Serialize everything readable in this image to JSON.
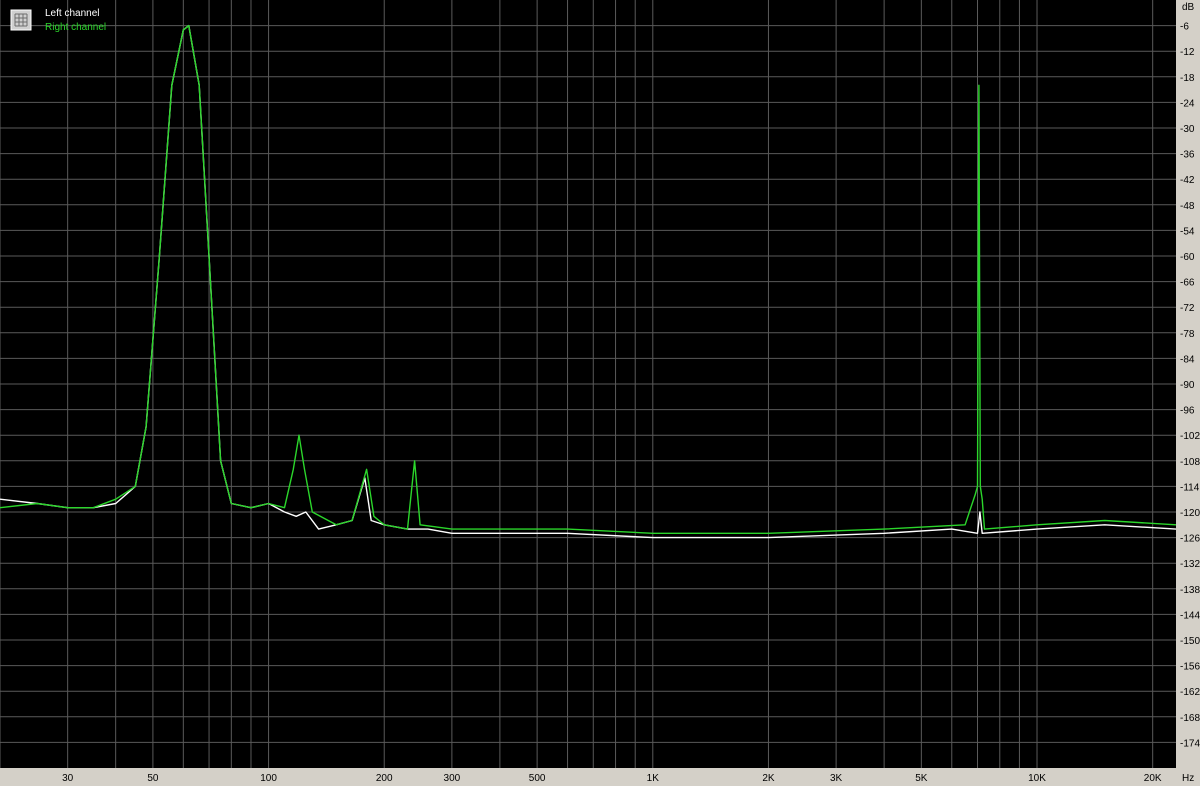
{
  "legend": {
    "left_label": "Left channel",
    "right_label": "Right channel",
    "left_color": "#ffffff",
    "right_color": "#2bd62b"
  },
  "chart_data": {
    "type": "line",
    "xscale": "log",
    "xlim": [
      20,
      23000
    ],
    "ylim": [
      -180,
      0
    ],
    "y_unit": "dB",
    "x_unit": "Hz",
    "grid": true,
    "legend_position": "top-left",
    "background": "#000000",
    "grid_color": "#5a5a5a",
    "x_tick_labels": [
      {
        "v": 30,
        "t": "30"
      },
      {
        "v": 50,
        "t": "50"
      },
      {
        "v": 100,
        "t": "100"
      },
      {
        "v": 200,
        "t": "200"
      },
      {
        "v": 300,
        "t": "300"
      },
      {
        "v": 500,
        "t": "500"
      },
      {
        "v": 1000,
        "t": "1K"
      },
      {
        "v": 2000,
        "t": "2K"
      },
      {
        "v": 3000,
        "t": "3K"
      },
      {
        "v": 5000,
        "t": "5K"
      },
      {
        "v": 10000,
        "t": "10K"
      },
      {
        "v": 20000,
        "t": "20K"
      }
    ],
    "y_ticks": [
      -6,
      -12,
      -18,
      -24,
      -30,
      -36,
      -42,
      -48,
      -54,
      -60,
      -66,
      -72,
      -78,
      -84,
      -90,
      -96,
      -102,
      -108,
      -114,
      -120,
      -126,
      -132,
      -138,
      -144,
      -150,
      -156,
      -162,
      -168,
      -174
    ],
    "series": [
      {
        "name": "Left channel",
        "color": "#ffffff",
        "points": [
          [
            20,
            -117
          ],
          [
            25,
            -118
          ],
          [
            30,
            -119
          ],
          [
            35,
            -119
          ],
          [
            40,
            -118
          ],
          [
            45,
            -114
          ],
          [
            48,
            -100
          ],
          [
            52,
            -60
          ],
          [
            56,
            -20
          ],
          [
            60,
            -7
          ],
          [
            62,
            -6
          ],
          [
            66,
            -20
          ],
          [
            70,
            -60
          ],
          [
            75,
            -108
          ],
          [
            80,
            -118
          ],
          [
            90,
            -119
          ],
          [
            100,
            -118
          ],
          [
            110,
            -120
          ],
          [
            118,
            -121
          ],
          [
            125,
            -120
          ],
          [
            135,
            -124
          ],
          [
            150,
            -123
          ],
          [
            165,
            -122
          ],
          [
            178,
            -112
          ],
          [
            185,
            -122
          ],
          [
            200,
            -123
          ],
          [
            230,
            -124
          ],
          [
            260,
            -124
          ],
          [
            300,
            -125
          ],
          [
            400,
            -125
          ],
          [
            600,
            -125
          ],
          [
            1000,
            -126
          ],
          [
            2000,
            -126
          ],
          [
            4000,
            -125
          ],
          [
            6000,
            -124
          ],
          [
            7000,
            -125
          ],
          [
            7100,
            -120
          ],
          [
            7200,
            -125
          ],
          [
            10000,
            -124
          ],
          [
            15000,
            -123
          ],
          [
            23000,
            -124
          ]
        ]
      },
      {
        "name": "Right channel",
        "color": "#2bd62b",
        "points": [
          [
            20,
            -119
          ],
          [
            25,
            -118
          ],
          [
            30,
            -119
          ],
          [
            35,
            -119
          ],
          [
            40,
            -117
          ],
          [
            45,
            -114
          ],
          [
            48,
            -100
          ],
          [
            52,
            -60
          ],
          [
            56,
            -20
          ],
          [
            60,
            -7
          ],
          [
            62,
            -6
          ],
          [
            66,
            -20
          ],
          [
            70,
            -60
          ],
          [
            75,
            -108
          ],
          [
            80,
            -118
          ],
          [
            90,
            -119
          ],
          [
            100,
            -118
          ],
          [
            110,
            -119
          ],
          [
            116,
            -110
          ],
          [
            120,
            -102
          ],
          [
            124,
            -110
          ],
          [
            130,
            -120
          ],
          [
            150,
            -123
          ],
          [
            165,
            -122
          ],
          [
            180,
            -110
          ],
          [
            188,
            -121
          ],
          [
            200,
            -123
          ],
          [
            230,
            -124
          ],
          [
            240,
            -108
          ],
          [
            248,
            -123
          ],
          [
            300,
            -124
          ],
          [
            400,
            -124
          ],
          [
            600,
            -124
          ],
          [
            1000,
            -125
          ],
          [
            2000,
            -125
          ],
          [
            4000,
            -124
          ],
          [
            6500,
            -123
          ],
          [
            6900,
            -116
          ],
          [
            7000,
            -114
          ],
          [
            7060,
            -20
          ],
          [
            7120,
            -114
          ],
          [
            7200,
            -117
          ],
          [
            7300,
            -124
          ],
          [
            10000,
            -123
          ],
          [
            15000,
            -122
          ],
          [
            23000,
            -123
          ]
        ]
      }
    ]
  }
}
